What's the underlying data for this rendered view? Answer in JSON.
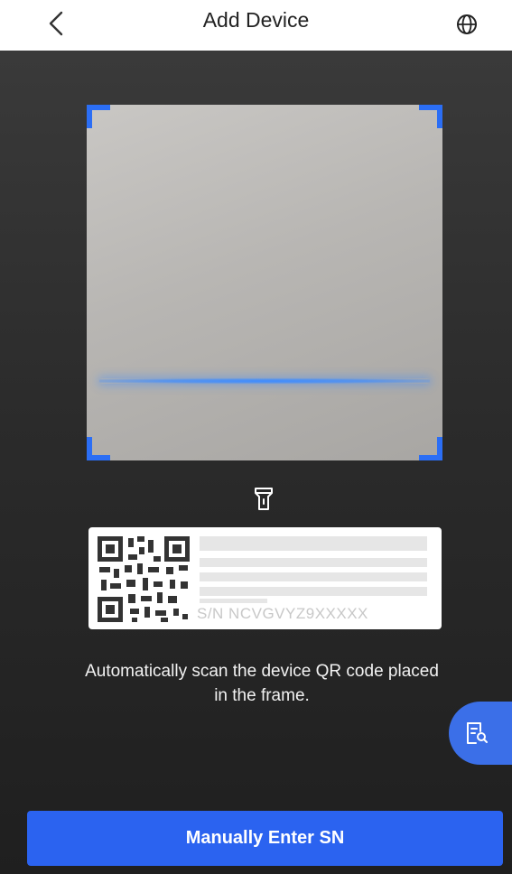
{
  "header": {
    "title": "Add Device"
  },
  "icons": {
    "back": "chevron-left-icon",
    "language": "globe-icon",
    "flashlight": "flashlight-icon",
    "fab": "document-search-icon"
  },
  "sn_card": {
    "sn_text": "S/N  NCVGVYZ9XXXXX"
  },
  "instruction": "Automatically scan the device QR code placed in the frame.",
  "manual_button": {
    "label": "Manually Enter SN"
  },
  "colors": {
    "accent": "#2b63f0",
    "frame_corner": "#2b6ef5",
    "scan_line": "#3e8cff"
  }
}
